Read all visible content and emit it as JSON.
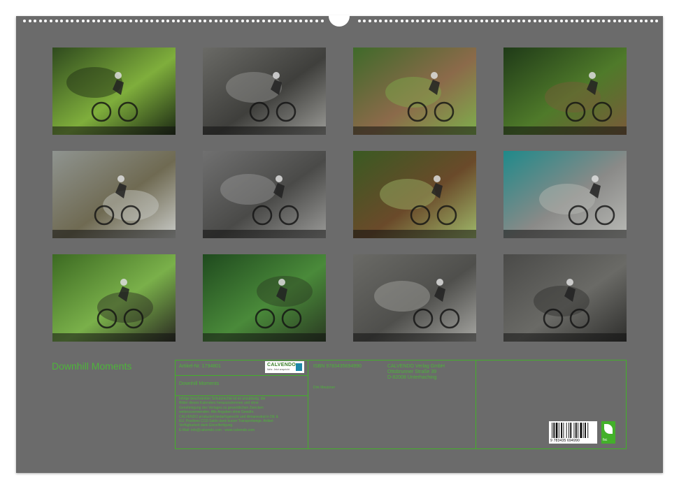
{
  "calendar": {
    "title": "Downhill Moments",
    "colors": {
      "sheet": "#6b6b6b",
      "accent": "#43b02a",
      "paper": "#ffffff"
    },
    "months": [
      {
        "name": "photo-jan",
        "colors": [
          "#2f4a1e",
          "#7fae3c",
          "#1c2a14"
        ]
      },
      {
        "name": "photo-feb",
        "colors": [
          "#6a6a66",
          "#3f3f3c",
          "#9a9a96"
        ]
      },
      {
        "name": "photo-mar",
        "colors": [
          "#3f6a2a",
          "#8b6a4a",
          "#7fae4c"
        ]
      },
      {
        "name": "photo-apr",
        "colors": [
          "#1f3a18",
          "#4f7a2a",
          "#7a5a3a"
        ]
      },
      {
        "name": "photo-may",
        "colors": [
          "#8f9490",
          "#6f6a52",
          "#c9cbc8"
        ]
      },
      {
        "name": "photo-jun",
        "colors": [
          "#707070",
          "#4a4a48",
          "#9a9a98"
        ]
      },
      {
        "name": "photo-jul",
        "colors": [
          "#3a5a22",
          "#6a4a2a",
          "#9fb86a"
        ]
      },
      {
        "name": "photo-aug",
        "colors": [
          "#1f8a8a",
          "#8a8a88",
          "#b9bab6"
        ]
      },
      {
        "name": "photo-sep",
        "colors": [
          "#3c6a22",
          "#7ab04a",
          "#2a2a22"
        ]
      },
      {
        "name": "photo-oct",
        "colors": [
          "#1f4a1e",
          "#4a8a3a",
          "#2a3a22"
        ]
      },
      {
        "name": "photo-nov",
        "colors": [
          "#6a6a66",
          "#4f4f4c",
          "#a6a6a2"
        ]
      },
      {
        "name": "photo-dec",
        "colors": [
          "#4a4a48",
          "#6a6a66",
          "#2e2e2c"
        ]
      }
    ]
  },
  "info": {
    "article": "Artikel-Nr. 1794801",
    "product_title": "Downhill Moments",
    "isbn": "ISBN 9783435694990",
    "author": "Dirk Meutzner",
    "publisher_lines": [
      "CALVENDO Verlag GmbH",
      "Ottobrunner Straße 39",
      "D-82008 Unterhaching"
    ],
    "legal_lines": [
      "Infolge beschränkter Schutzrechte ist es unzulässig, die",
      "Bilder dieses Kalenders herauszutrennen und ohne",
      "Genehmigung des Verlages zu gewerblichen Zwecken",
      "weiterzuverwenden. Alle Angaben ohne Gewähr.",
      "CALVENDO produziert bedarfsgerecht und klimaneutral in DE &",
      "EU. Positives CO2-Saldo dank kurzer Transportwege. Artikel-",
      "Verfügbarkeit dank Einzelfertigung.",
      "E-Mail: info@calvendo.com · www.calvendo.com"
    ],
    "logo_text": "CALVENDO",
    "logo_sub": "Nehr. Jetzt anspricht",
    "barcode_number": "9 783435 694990",
    "fsc_label": "fsc"
  }
}
